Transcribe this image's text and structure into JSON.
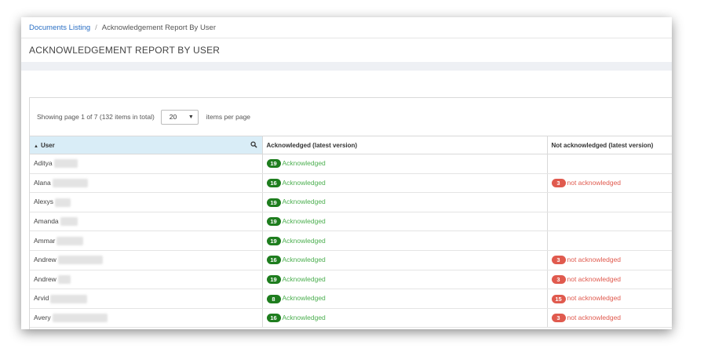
{
  "breadcrumb": {
    "link": "Documents Listing",
    "separator": "/",
    "current": "Acknowledgement Report By User"
  },
  "page_title": "ACKNOWLEDGEMENT REPORT BY USER",
  "pager": {
    "showing": "Showing page 1 of 7 (132 items in total)",
    "page_size": "20",
    "items_per_page": "items per page"
  },
  "table": {
    "headers": {
      "user": "User",
      "ack": "Acknowledged (latest version)",
      "nack": "Not acknowledged (latest version)"
    },
    "ack_label": "Acknowledged",
    "nack_label": "not acknowledged",
    "rows": [
      {
        "name": "Aditya",
        "ack": "19",
        "nack": ""
      },
      {
        "name": "Alana",
        "ack": "16",
        "nack": "3"
      },
      {
        "name": "Alexys",
        "ack": "19",
        "nack": ""
      },
      {
        "name": "Amanda",
        "ack": "19",
        "nack": ""
      },
      {
        "name": "Ammar",
        "ack": "19",
        "nack": ""
      },
      {
        "name": "Andrew",
        "ack": "16",
        "nack": "3"
      },
      {
        "name": "Andrew",
        "ack": "19",
        "nack": "3"
      },
      {
        "name": "Arvid",
        "ack": "8",
        "nack": "15"
      },
      {
        "name": "Avery",
        "ack": "16",
        "nack": "3"
      }
    ]
  },
  "colors": {
    "ack_badge": "#1e7d1e",
    "ack_text": "#4caf50",
    "nack": "#e05a4e",
    "link": "#2a6fc4",
    "sorted_header": "#d9edf7"
  }
}
